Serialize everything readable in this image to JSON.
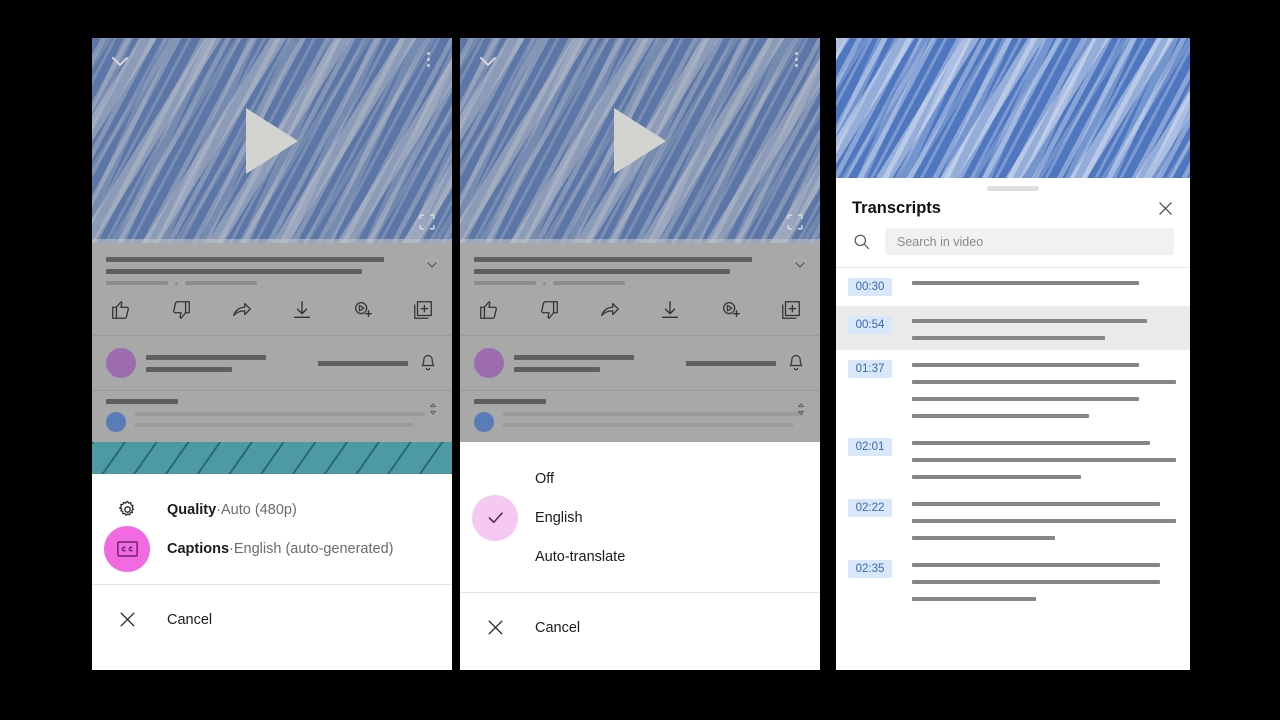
{
  "screen": {
    "background": "#000000",
    "accent_magenta": "#f16ae2",
    "accent_pink": "#f6c9f2",
    "timestamp_chip_bg": "#d9e7fb",
    "timestamp_chip_fg": "#3a6ab0",
    "video_blue": "#4e77c0",
    "teal_band": "#4e9aa2"
  },
  "panel_1": {
    "name": "Video page with settings bottom sheet",
    "player": {
      "collapse_icon": "chevron-down-icon",
      "more_icon": "kebab-menu-icon",
      "play_icon": "play-icon",
      "fullscreen_icon": "fullscreen-icon"
    },
    "actions": [
      {
        "name": "like-icon",
        "label": "Like"
      },
      {
        "name": "dislike-icon",
        "label": "Dislike"
      },
      {
        "name": "share-icon",
        "label": "Share"
      },
      {
        "name": "download-icon",
        "label": "Download"
      },
      {
        "name": "remix-icon",
        "label": "Remix"
      },
      {
        "name": "save-icon",
        "label": "Save"
      }
    ],
    "subscribe_bell_icon": "bell-icon",
    "comment_sort_icon": "sort-icon",
    "sheet": {
      "items": [
        {
          "icon": "gear-icon",
          "title": "Quality",
          "separator": "·",
          "value": "Auto (480p)",
          "highlight": "none"
        },
        {
          "icon": "closed-captions-icon",
          "title": "Captions",
          "separator": "·",
          "value": "English (auto-generated)",
          "highlight": "magenta"
        }
      ],
      "cancel": {
        "icon": "close-icon",
        "label": "Cancel"
      }
    }
  },
  "panel_2": {
    "name": "Captions language picker bottom sheet",
    "player": {
      "collapse_icon": "chevron-down-icon",
      "more_icon": "kebab-menu-icon",
      "play_icon": "play-icon",
      "fullscreen_icon": "fullscreen-icon"
    },
    "actions": [
      {
        "name": "like-icon",
        "label": "Like"
      },
      {
        "name": "dislike-icon",
        "label": "Dislike"
      },
      {
        "name": "share-icon",
        "label": "Share"
      },
      {
        "name": "download-icon",
        "label": "Download"
      },
      {
        "name": "remix-icon",
        "label": "Remix"
      },
      {
        "name": "save-icon",
        "label": "Save"
      }
    ],
    "subscribe_bell_icon": "bell-icon",
    "comment_sort_icon": "sort-icon",
    "sheet": {
      "options": [
        {
          "label": "Off",
          "selected": false,
          "icon": "none"
        },
        {
          "label": "English",
          "selected": true,
          "icon": "check-icon"
        },
        {
          "label": "Auto-translate",
          "selected": false,
          "icon": "none"
        }
      ],
      "cancel": {
        "icon": "close-icon",
        "label": "Cancel"
      }
    }
  },
  "panel_3": {
    "name": "Transcripts panel",
    "grab_handle": "drag-handle",
    "title": "Transcripts",
    "close_icon": "close-icon",
    "search": {
      "icon": "search-icon",
      "placeholder": "Search in video",
      "value": ""
    },
    "entries": [
      {
        "time": "00:30",
        "active": false,
        "lines": [
          86
        ]
      },
      {
        "time": "00:54",
        "active": true,
        "lines": [
          89,
          73
        ]
      },
      {
        "time": "01:37",
        "active": false,
        "lines": [
          86,
          100,
          86,
          67
        ]
      },
      {
        "time": "02:01",
        "active": false,
        "lines": [
          90,
          100,
          64
        ]
      },
      {
        "time": "02:22",
        "active": false,
        "lines": [
          94,
          100,
          54
        ]
      },
      {
        "time": "02:35",
        "active": false,
        "lines": [
          94,
          94,
          47
        ]
      }
    ]
  }
}
